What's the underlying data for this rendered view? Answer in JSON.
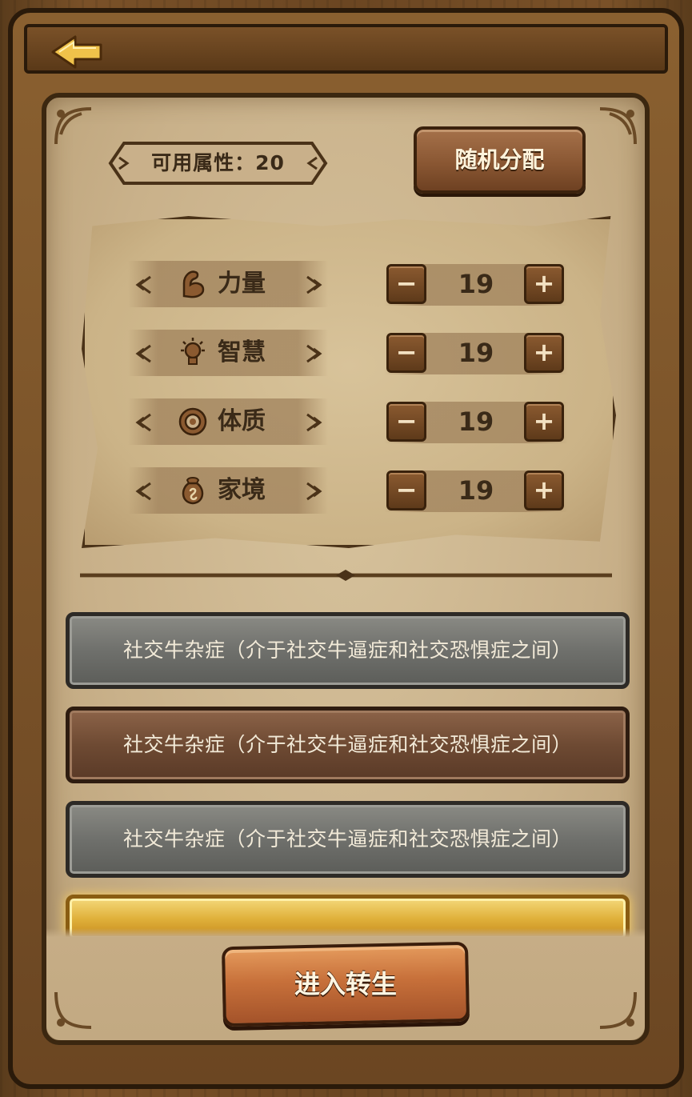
{
  "header": {
    "back_icon": "back-arrow-icon"
  },
  "points": {
    "label": "可用属性：",
    "value": "20",
    "text": "可用属性：20"
  },
  "random_button": {
    "label": "随机分配"
  },
  "attributes": [
    {
      "name": "力量",
      "icon": "strength-arm-icon",
      "value": "19",
      "minus": "−",
      "plus": "+"
    },
    {
      "name": "智慧",
      "icon": "wisdom-bulb-icon",
      "value": "19",
      "minus": "−",
      "plus": "+"
    },
    {
      "name": "体质",
      "icon": "constitution-shield-icon",
      "value": "19",
      "minus": "−",
      "plus": "+"
    },
    {
      "name": "家境",
      "icon": "family-bag-icon",
      "value": "19",
      "minus": "−",
      "plus": "+"
    }
  ],
  "talents": [
    {
      "text": "社交牛杂症（介于社交牛逼症和社交恐惧症之间）",
      "grade": "gray"
    },
    {
      "text": "社交牛杂症（介于社交牛逼症和社交恐惧症之间）",
      "grade": "brown"
    },
    {
      "text": "社交牛杂症（介于社交牛逼症和社交恐惧症之间）",
      "grade": "gray"
    },
    {
      "text": "",
      "grade": "gold"
    }
  ],
  "enter_button": {
    "label": "进入转生"
  },
  "colors": {
    "panel": "#c8b08a",
    "wood": "#6b4622",
    "gold": "#e0b13b",
    "gray": "#6f706c",
    "brown": "#6e4a33"
  }
}
